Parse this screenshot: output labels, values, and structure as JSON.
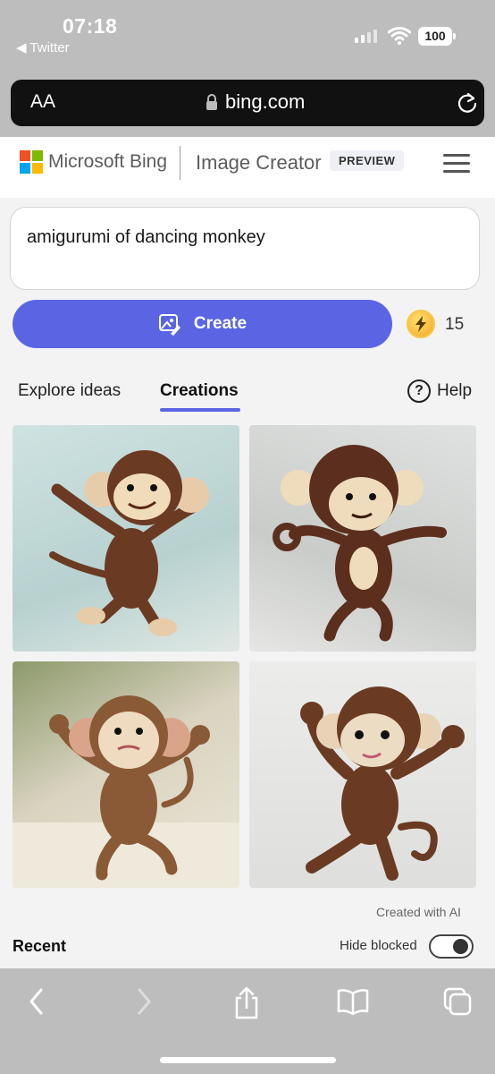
{
  "status_bar": {
    "time": "07:18",
    "back_app": "◀ Twitter",
    "battery": "100",
    "icons": [
      "signal-icon",
      "wifi-icon",
      "battery-icon"
    ]
  },
  "browser": {
    "text_size_label": "AA",
    "url": "bing.com",
    "icons": [
      "lock-icon",
      "reload-icon"
    ]
  },
  "header": {
    "brand": "Microsoft Bing",
    "product": "Image Creator",
    "badge": "PREVIEW"
  },
  "prompt": {
    "value": "amigurumi of dancing monkey"
  },
  "create": {
    "label": "Create",
    "boost_count": "15",
    "accent": "#5b65e3"
  },
  "tabs": [
    {
      "label": "Explore ideas",
      "active": false
    },
    {
      "label": "Creations",
      "active": true
    }
  ],
  "help": {
    "label": "Help"
  },
  "images": [
    {
      "name": "generated-image-1"
    },
    {
      "name": "generated-image-2"
    },
    {
      "name": "generated-image-3"
    },
    {
      "name": "generated-image-4"
    }
  ],
  "created_with_ai": "Created with AI",
  "recent": {
    "title": "Recent",
    "hide_blocked_label": "Hide blocked",
    "hide_blocked_on": true
  },
  "toolbar": {
    "icons": [
      "back-icon",
      "forward-icon",
      "share-icon",
      "bookmarks-icon",
      "tabs-icon"
    ]
  }
}
